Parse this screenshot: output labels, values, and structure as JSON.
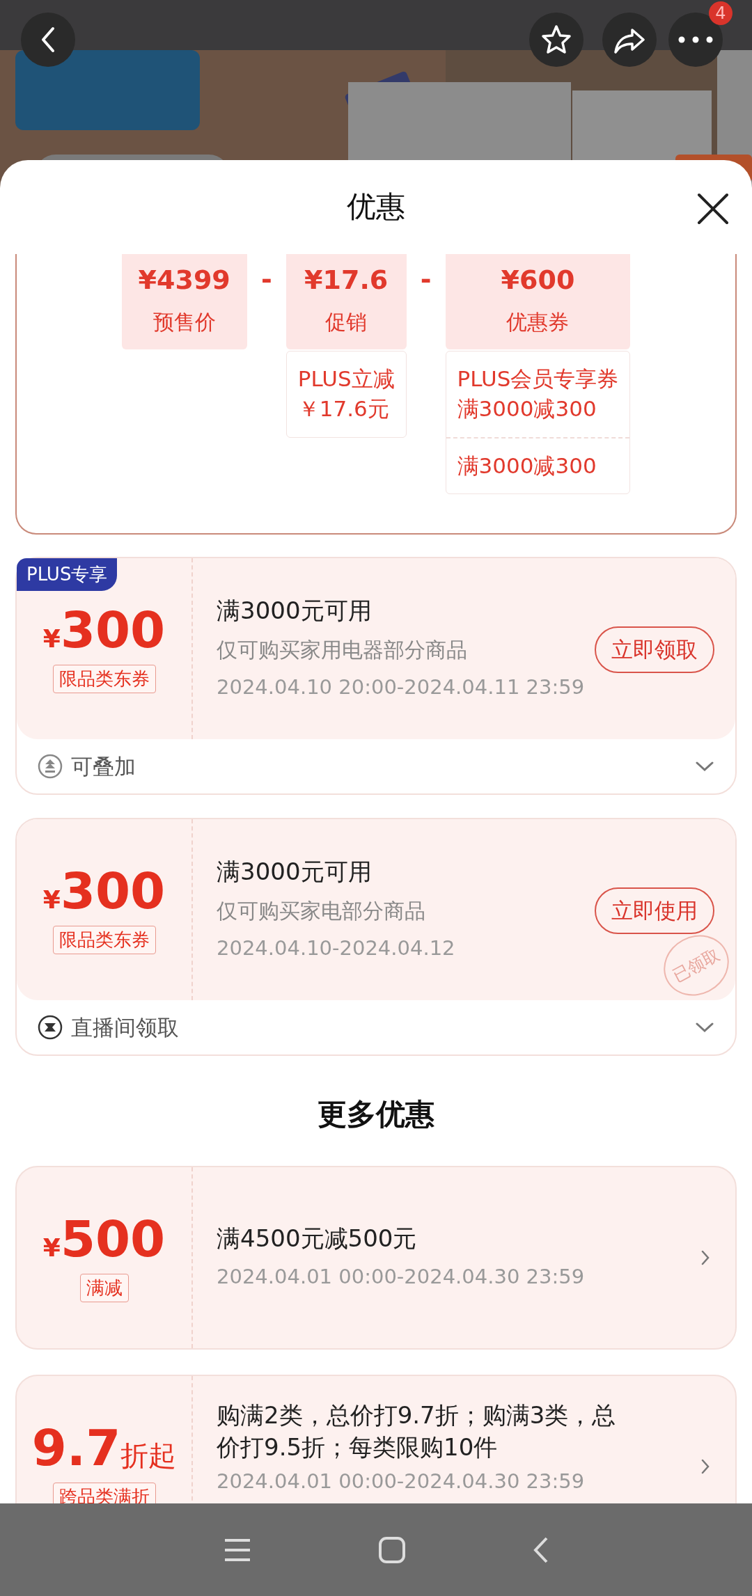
{
  "top_bar": {
    "badge": "4"
  },
  "sheet": {
    "title": "优惠"
  },
  "breakdown": {
    "items": [
      {
        "amount": "¥4399",
        "label": "预售价"
      },
      {
        "operator": "-",
        "amount": "¥17.6",
        "label": "促销",
        "details": [
          [
            "PLUS立减",
            "￥17.6元"
          ]
        ]
      },
      {
        "operator": "-",
        "amount": "¥600",
        "label": "优惠券",
        "details": [
          [
            "PLUS会员专享券",
            "满3000减300"
          ],
          [
            "满3000减300"
          ]
        ]
      }
    ]
  },
  "coupons": [
    {
      "badge": "PLUS专享",
      "currency": "¥",
      "amount": "300",
      "tag": "限品类东券",
      "title": "满3000元可用",
      "subtitle": "仅可购买家用电器部分商品",
      "validity": "2024.04.10 20:00-2024.04.11 23:59",
      "action": "立即领取",
      "footer": {
        "kind": "stackable",
        "text": "可叠加"
      }
    },
    {
      "currency": "¥",
      "amount": "300",
      "tag": "限品类东券",
      "title": "满3000元可用",
      "subtitle": "仅可购买家电部分商品",
      "validity": "2024.04.10-2024.04.12",
      "action": "立即使用",
      "stamp": "已领取",
      "footer": {
        "kind": "live",
        "text": "直播间领取"
      }
    }
  ],
  "more_heading": "更多优惠",
  "more_offers": [
    {
      "currency": "¥",
      "amount": "500",
      "tag": "满减",
      "title": "满4500元减500元",
      "validity": "2024.04.01 00:00-2024.04.30 23:59"
    },
    {
      "amount": "9.7",
      "unit": "折起",
      "tag": "跨品类满折",
      "title": "购满2类，总价打9.7折；购满3类，总价打9.5折；每类限购10件",
      "validity": "2024.04.01 00:00-2024.04.30 23:59"
    }
  ]
}
